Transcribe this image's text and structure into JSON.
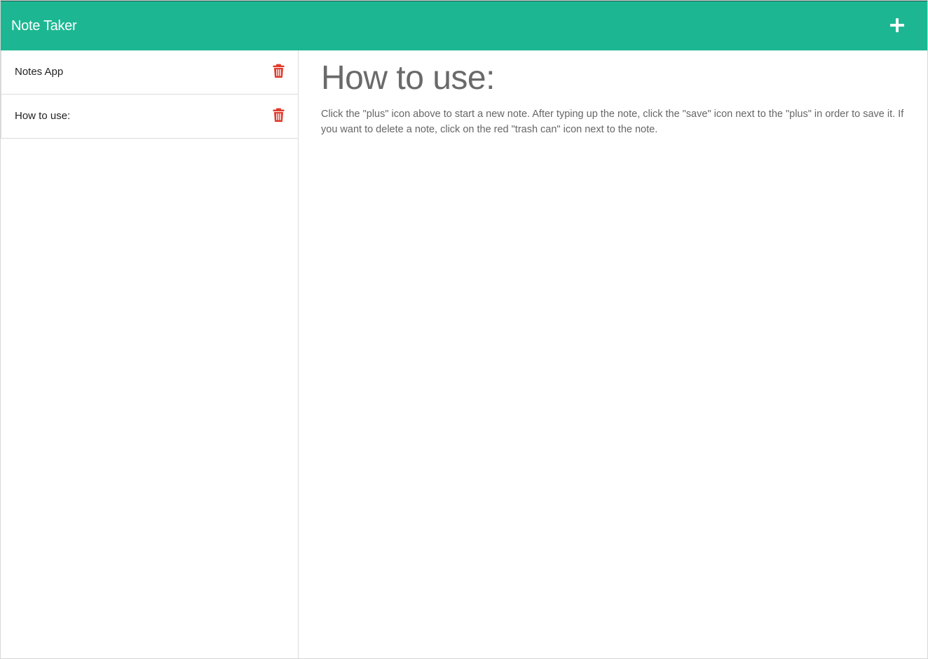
{
  "navbar": {
    "brand": "Note Taker",
    "new_note_icon": "plus-icon",
    "color": "#1cb792"
  },
  "notes": [
    {
      "title": "Notes App",
      "delete_icon": "trash-icon"
    },
    {
      "title": "How to use:",
      "delete_icon": "trash-icon"
    }
  ],
  "active_note": {
    "title": "How to use:",
    "text": "Click the \"plus\" icon above to start a new note. After typing up the note, click the \"save\" icon next to the \"plus\" in order to save it. If you want to delete a note, click on the red \"trash can\" icon next to the note."
  },
  "colors": {
    "accent": "#1cb792",
    "delete": "#e03b2c",
    "heading": "#6a6a6a",
    "body_text": "#666666"
  }
}
